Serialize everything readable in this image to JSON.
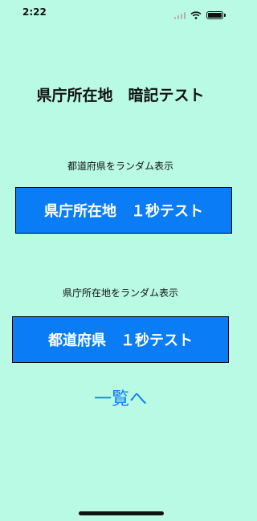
{
  "status_bar": {
    "time": "2:22",
    "icons": [
      "signal-icon",
      "wifi-icon",
      "battery-icon"
    ]
  },
  "main": {
    "title": "県庁所在地　暗記テスト",
    "caption_prefecture": "都道府県をランダム表示",
    "button_capital_test": "県庁所在地　１秒テスト",
    "caption_capital": "県庁所在地をランダム表示",
    "button_prefecture_test": "都道府県　１秒テスト",
    "list_link": "一覧へ"
  },
  "colors": {
    "background": "#b9fae5",
    "button": "#0a7cf6",
    "link": "#0a7cf6"
  }
}
